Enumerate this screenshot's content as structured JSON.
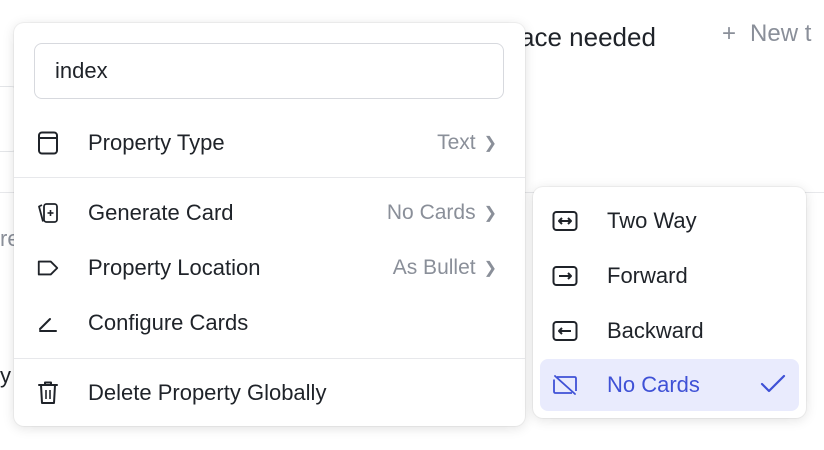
{
  "background": {
    "title_fragment": "ace needed",
    "new_tab_fragment": "New t",
    "stub_1": "re",
    "stub_2": "y"
  },
  "menu": {
    "search_value": "index",
    "items": [
      {
        "label": "Property Type",
        "value": "Text",
        "icon": "calculator-icon"
      },
      {
        "label": "Generate Card",
        "value": "No Cards",
        "icon": "cards-icon"
      },
      {
        "label": "Property Location",
        "value": "As Bullet",
        "icon": "tag-icon"
      },
      {
        "label": "Configure Cards",
        "icon": "pen-icon"
      },
      {
        "label": "Delete Property Globally",
        "icon": "trash-icon"
      }
    ]
  },
  "submenu": {
    "items": [
      {
        "label": "Two Way",
        "icon": "two-way-arrow-icon"
      },
      {
        "label": "Forward",
        "icon": "forward-arrow-icon"
      },
      {
        "label": "Backward",
        "icon": "backward-arrow-icon"
      },
      {
        "label": "No Cards",
        "icon": "no-cards-icon",
        "selected": true
      }
    ]
  },
  "colors": {
    "accent": "#3f51d6",
    "selected_bg": "#e9ebfd",
    "muted_text": "#8a8f99"
  }
}
